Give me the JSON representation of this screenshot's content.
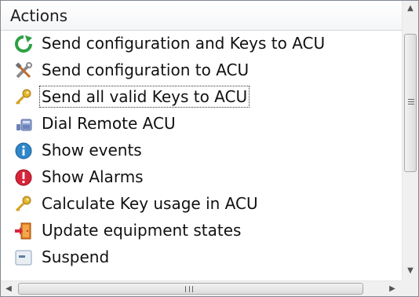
{
  "header": {
    "title": "Actions"
  },
  "actions": [
    {
      "label": "Send configuration and Keys to ACU",
      "icon": "refresh-icon"
    },
    {
      "label": "Send configuration to ACU",
      "icon": "tools-icon"
    },
    {
      "label": "Send all valid Keys to ACU",
      "icon": "key-icon",
      "selected": true
    },
    {
      "label": "Dial Remote ACU",
      "icon": "phone-icon"
    },
    {
      "label": "Show events",
      "icon": "info-icon"
    },
    {
      "label": "Show Alarms",
      "icon": "alarm-icon"
    },
    {
      "label": "Calculate Key usage in ACU",
      "icon": "key-icon"
    },
    {
      "label": "Update equipment states",
      "icon": "door-icon"
    },
    {
      "label": "Suspend",
      "icon": "suspend-icon"
    }
  ],
  "scrollbars": {
    "vertical": {
      "up_glyph": "▲",
      "down_glyph": "▼"
    },
    "horizontal": {
      "left_glyph": "◀",
      "right_glyph": "▶"
    }
  },
  "colors": {
    "refresh": "#2fa043",
    "info": "#2f86c9",
    "alarm": "#d6243a",
    "key": "#d4a020"
  }
}
